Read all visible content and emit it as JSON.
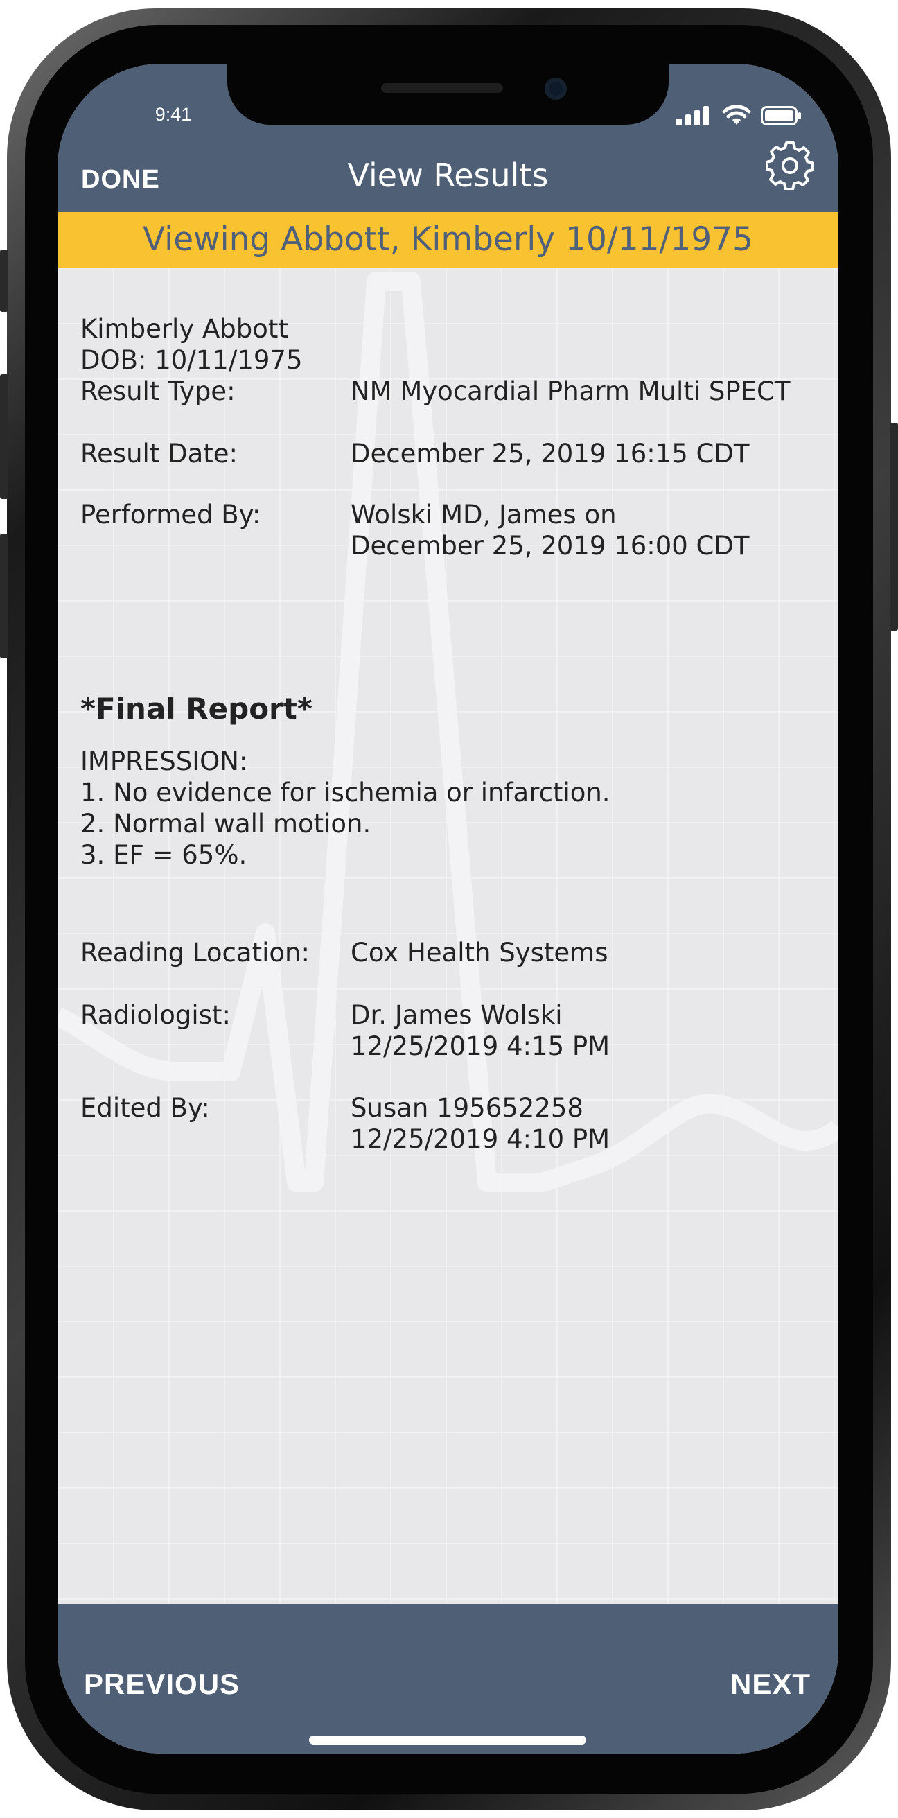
{
  "status_bar": {
    "time": "9:41"
  },
  "header": {
    "done_label": "DONE",
    "title": "View Results",
    "settings_icon": "gear-icon"
  },
  "banner": {
    "text": "Viewing Abbott, Kimberly 10/11/1975"
  },
  "patient": {
    "name": "Kimberly Abbott",
    "dob": "DOB: 10/11/1975"
  },
  "details": [
    {
      "label": "Result Type:",
      "value_lines": [
        "NM Myocardial Pharm Multi SPECT"
      ]
    },
    {
      "label": "Result Date:",
      "value_lines": [
        "December 25, 2019  16:15 CDT"
      ]
    },
    {
      "label": "Performed By:",
      "value_lines": [
        "Wolski MD, James on",
        "December 25, 2019  16:00 CDT"
      ]
    }
  ],
  "report": {
    "title": "*Final Report*",
    "lines": [
      "IMPRESSION:",
      "1. No evidence for ischemia or infarction.",
      "2. Normal wall motion.",
      "3. EF = 65%."
    ]
  },
  "footer_details": [
    {
      "label": "Reading Location:",
      "value_lines": [
        "Cox Health Systems"
      ]
    },
    {
      "label": "Radiologist:",
      "value_lines": [
        "Dr. James Wolski",
        "12/25/2019  4:15 PM"
      ]
    },
    {
      "label": "Edited By:",
      "value_lines": [
        "Susan 195652258",
        "12/25/2019  4:10 PM"
      ]
    }
  ],
  "footer": {
    "previous_label": "PREVIOUS",
    "next_label": "NEXT"
  },
  "colors": {
    "header_bg": "#4f5f76",
    "banner_bg": "#f8c230",
    "banner_text": "#50607a",
    "content_bg": "#e8e8eb"
  }
}
